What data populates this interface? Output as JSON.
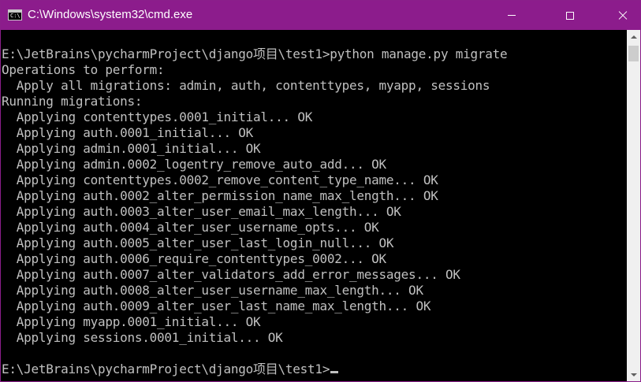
{
  "window": {
    "title": "C:\\Windows\\system32\\cmd.exe",
    "app_icon_text": "C:\\",
    "controls": [
      "minimize",
      "maximize",
      "close"
    ]
  },
  "console": {
    "lines": [
      "E:\\JetBrains\\pycharmProject\\django项目\\test1>python manage.py migrate",
      "Operations to perform:",
      "  Apply all migrations: admin, auth, contenttypes, myapp, sessions",
      "Running migrations:",
      "  Applying contenttypes.0001_initial... OK",
      "  Applying auth.0001_initial... OK",
      "  Applying admin.0001_initial... OK",
      "  Applying admin.0002_logentry_remove_auto_add... OK",
      "  Applying contenttypes.0002_remove_content_type_name... OK",
      "  Applying auth.0002_alter_permission_name_max_length... OK",
      "  Applying auth.0003_alter_user_email_max_length... OK",
      "  Applying auth.0004_alter_user_username_opts... OK",
      "  Applying auth.0005_alter_user_last_login_null... OK",
      "  Applying auth.0006_require_contenttypes_0002... OK",
      "  Applying auth.0007_alter_validators_add_error_messages... OK",
      "  Applying auth.0008_alter_user_username_max_length... OK",
      "  Applying auth.0009_alter_user_last_name_max_length... OK",
      "  Applying myapp.0001_initial... OK",
      "  Applying sessions.0001_initial... OK",
      ""
    ],
    "prompt": "E:\\JetBrains\\pycharmProject\\django项目\\test1>"
  },
  "colors": {
    "title_bar": "#8c1c8c",
    "console_bg": "#000000",
    "console_fg": "#c0c0c0",
    "scrollbar": "#f0f0f0"
  },
  "icons": {
    "app": "cmd-icon",
    "minimize": "minimize-icon",
    "maximize": "maximize-icon",
    "close": "close-icon"
  }
}
